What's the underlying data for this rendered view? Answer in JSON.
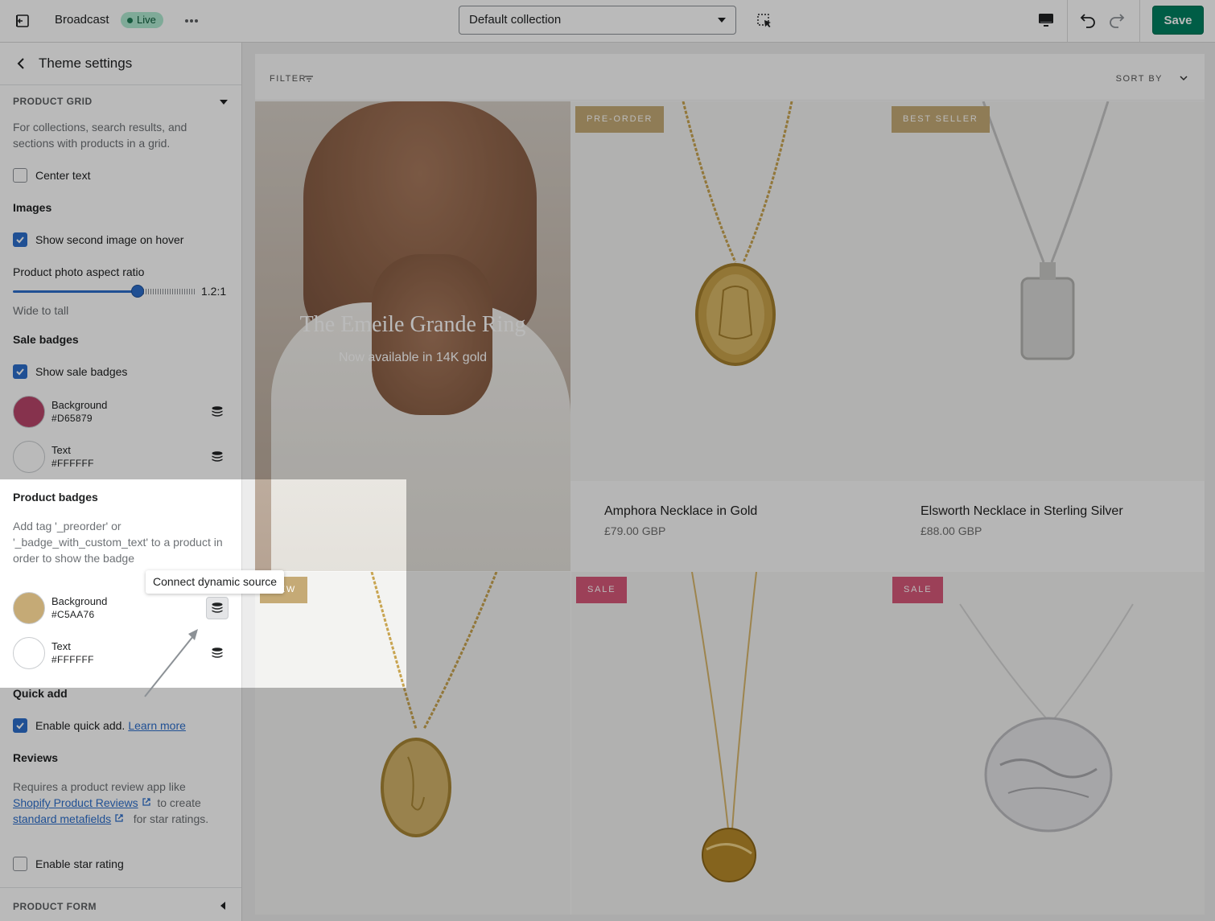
{
  "topbar": {
    "store_name": "Broadcast",
    "status_badge": "Live",
    "template_select": "Default collection",
    "save_label": "Save",
    "icons": [
      "exit-icon",
      "more-icon",
      "inspector-icon",
      "desktop-icon",
      "undo-icon",
      "redo-icon"
    ]
  },
  "sidebar": {
    "title": "Theme settings",
    "product_grid": {
      "label": "PRODUCT GRID",
      "description": "For collections, search results, and sections with products in a grid.",
      "center_text": {
        "label": "Center text",
        "checked": false
      },
      "images_heading": "Images",
      "second_image": {
        "label": "Show second image on hover",
        "checked": true
      },
      "aspect_ratio": {
        "label": "Product photo aspect ratio",
        "value": "1.2:1",
        "hint": "Wide to tall",
        "level": 0.68
      },
      "sale_badges_heading": "Sale badges",
      "show_sale_badges": {
        "label": "Show sale badges",
        "checked": true
      },
      "sale_colors": [
        {
          "name": "Background",
          "hex": "#D65879",
          "color": "#B8456A"
        },
        {
          "name": "Text",
          "hex": "#FFFFFF",
          "color": "#FFFFFF"
        }
      ],
      "product_badges_heading": "Product badges",
      "product_badges_description": "Add tag '_preorder' or '_badge_with_custom_text' to a product in order to show the badge",
      "badge_colors": [
        {
          "name": "Background",
          "hex": "#C5AA76",
          "color": "#C5AA76"
        },
        {
          "name": "Text",
          "hex": "#FFFFFF",
          "color": "#FFFFFF"
        }
      ],
      "tooltip": "Connect dynamic source",
      "quick_add_heading": "Quick add",
      "quick_add": {
        "label": "Enable quick add.",
        "link": "Learn more",
        "checked": true
      },
      "reviews_heading": "Reviews",
      "reviews_text_1": "Requires a product review app like",
      "reviews_link_1": "Shopify Product Reviews",
      "reviews_text_2": "to create",
      "reviews_link_2": "standard metafields",
      "reviews_text_3": "for star ratings.",
      "star_rating": {
        "label": "Enable star rating",
        "checked": false
      }
    },
    "product_form": {
      "label": "PRODUCT FORM"
    }
  },
  "preview": {
    "filter_label": "FILTER",
    "sort_label": "SORT BY",
    "hero": {
      "title": "The Emeile Grande Ring",
      "subtitle": "Now available in 14K gold"
    },
    "products": [
      {
        "badge": "PRE-ORDER",
        "badge_color": "#C5AA76",
        "name": "Amphora Necklace in Gold",
        "price": "£79.00 GBP"
      },
      {
        "badge": "BEST SELLER",
        "badge_color": "#C5AA76",
        "name": "Elsworth Necklace in Sterling Silver",
        "price": "£88.00 GBP"
      },
      {
        "badge": "NEW",
        "badge_color": "#C5AA76",
        "name": "",
        "price": ""
      },
      {
        "badge": "SALE",
        "badge_color": "#D65879",
        "name": "",
        "price": ""
      },
      {
        "badge": "SALE",
        "badge_color": "#D65879",
        "name": "",
        "price": ""
      }
    ]
  }
}
